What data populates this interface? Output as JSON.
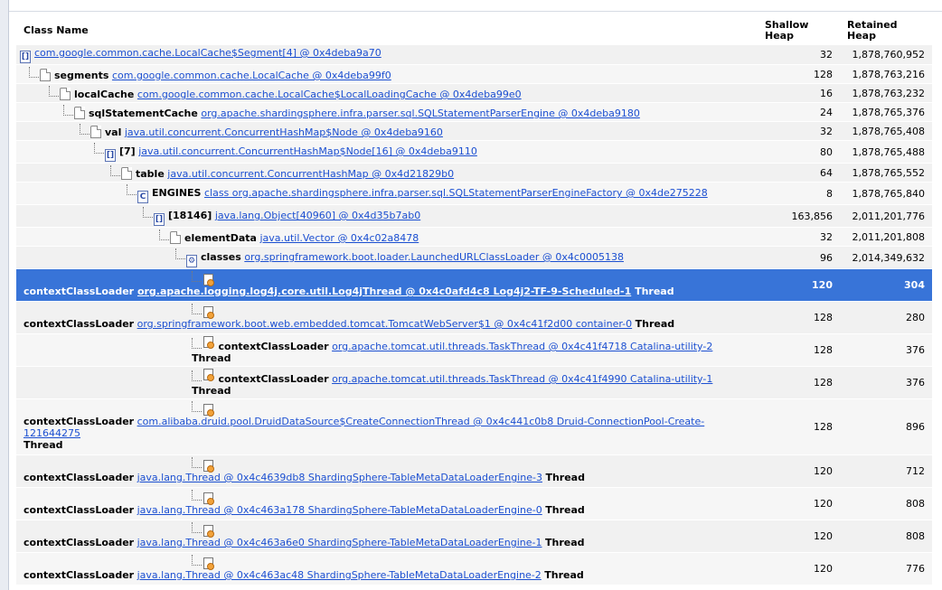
{
  "headers": {
    "class_name": "Class Name",
    "shallow": "Shallow\nHeap",
    "retained": "Retained\nHeap"
  },
  "rows": [
    {
      "label": "",
      "link": "com.google.common.cache.LocalCache$Segment[4] @ 0x4deba9a70",
      "tail": "",
      "shallow": "32",
      "retained": "1,878,760,952"
    },
    {
      "label": "segments",
      "link": "com.google.common.cache.LocalCache @ 0x4deba99f0",
      "tail": "",
      "shallow": "128",
      "retained": "1,878,763,216"
    },
    {
      "label": "localCache",
      "link": "com.google.common.cache.LocalCache$LocalLoadingCache @ 0x4deba99e0",
      "tail": "",
      "shallow": "16",
      "retained": "1,878,763,232"
    },
    {
      "label": "sqlStatementCache",
      "link": "org.apache.shardingsphere.infra.parser.sql.SQLStatementParserEngine @ 0x4deba9180",
      "tail": "",
      "shallow": "24",
      "retained": "1,878,765,376"
    },
    {
      "label": "val",
      "link": "java.util.concurrent.ConcurrentHashMap$Node @ 0x4deba9160",
      "tail": "",
      "shallow": "32",
      "retained": "1,878,765,408"
    },
    {
      "label": "[7]",
      "link": "java.util.concurrent.ConcurrentHashMap$Node[16] @ 0x4deba9110",
      "tail": "",
      "shallow": "80",
      "retained": "1,878,765,488"
    },
    {
      "label": "table",
      "link": "java.util.concurrent.ConcurrentHashMap @ 0x4d21829b0",
      "tail": "",
      "shallow": "64",
      "retained": "1,878,765,552"
    },
    {
      "label": "ENGINES",
      "link": "class org.apache.shardingsphere.infra.parser.sql.SQLStatementParserEngineFactory @ 0x4de275228",
      "tail": "",
      "shallow": "8",
      "retained": "1,878,765,840"
    },
    {
      "label": "[18146]",
      "link": "java.lang.Object[40960] @ 0x4d35b7ab0",
      "tail": "",
      "shallow": "163,856",
      "retained": "2,011,201,776"
    },
    {
      "label": "elementData",
      "link": "java.util.Vector @ 0x4c02a8478",
      "tail": "",
      "shallow": "32",
      "retained": "2,011,201,808"
    },
    {
      "label": "classes",
      "link": "org.springframework.boot.loader.LaunchedURLClassLoader @ 0x4c0005138",
      "tail": "",
      "shallow": "96",
      "retained": "2,014,349,632"
    },
    {
      "label": "contextClassLoader",
      "link": "org.apache.logging.log4j.core.util.Log4jThread @ 0x4c0afd4c8 Log4j2-TF-9-Scheduled-1",
      "tail": "Thread",
      "shallow": "120",
      "retained": "304"
    },
    {
      "label": "contextClassLoader",
      "link": "org.springframework.boot.web.embedded.tomcat.TomcatWebServer$1 @ 0x4c41f2d00 container-0",
      "tail": "Thread",
      "shallow": "128",
      "retained": "280"
    },
    {
      "label": "contextClassLoader",
      "link": "org.apache.tomcat.util.threads.TaskThread @ 0x4c41f4718 Catalina-utility-2",
      "tail": "Thread",
      "shallow": "128",
      "retained": "376"
    },
    {
      "label": "contextClassLoader",
      "link": "org.apache.tomcat.util.threads.TaskThread @ 0x4c41f4990 Catalina-utility-1",
      "tail": "Thread",
      "shallow": "128",
      "retained": "376"
    },
    {
      "label": "contextClassLoader",
      "link": "com.alibaba.druid.pool.DruidDataSource$CreateConnectionThread @ 0x4c441c0b8 Druid-ConnectionPool-Create-121644275",
      "tail": "Thread",
      "shallow": "128",
      "retained": "896"
    },
    {
      "label": "contextClassLoader",
      "link": "java.lang.Thread @ 0x4c4639db8 ShardingSphere-TableMetaDataLoaderEngine-3",
      "tail": "Thread",
      "shallow": "120",
      "retained": "712"
    },
    {
      "label": "contextClassLoader",
      "link": "java.lang.Thread @ 0x4c463a178 ShardingSphere-TableMetaDataLoaderEngine-0",
      "tail": "Thread",
      "shallow": "120",
      "retained": "808"
    },
    {
      "label": "contextClassLoader",
      "link": "java.lang.Thread @ 0x4c463a6e0 ShardingSphere-TableMetaDataLoaderEngine-1",
      "tail": "Thread",
      "shallow": "120",
      "retained": "808"
    },
    {
      "label": "contextClassLoader",
      "link": "java.lang.Thread @ 0x4c463ac48 ShardingSphere-TableMetaDataLoaderEngine-2",
      "tail": "Thread",
      "shallow": "120",
      "retained": "776"
    }
  ]
}
